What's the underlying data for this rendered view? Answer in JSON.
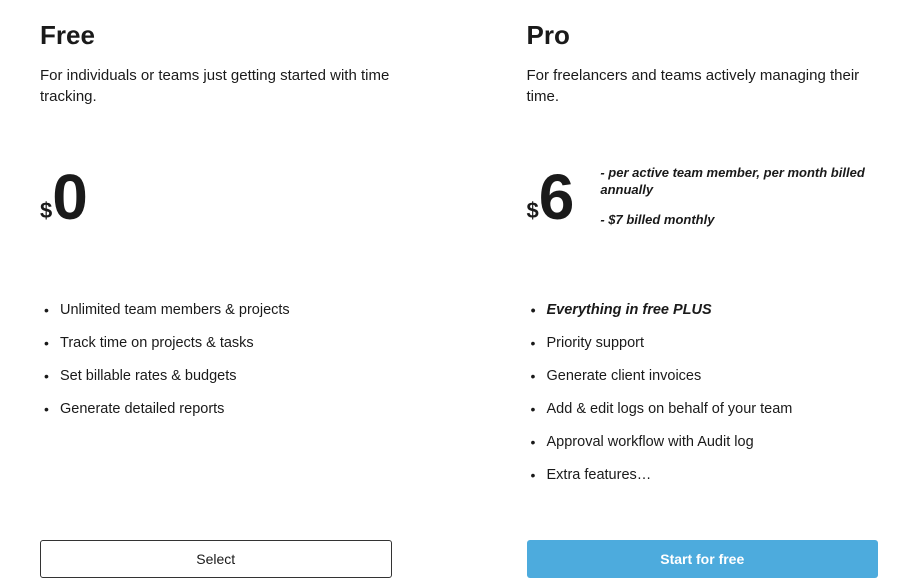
{
  "plans": {
    "free": {
      "title": "Free",
      "description": "For individuals or teams just getting started with time tracking.",
      "currency": "$",
      "amount": "0",
      "features": [
        "Unlimited team members & projects",
        "Track time on projects & tasks",
        "Set billable rates & budgets",
        "Generate detailed reports"
      ],
      "button_label": "Select"
    },
    "pro": {
      "title": "Pro",
      "description": "For freelancers and teams actively managing their time.",
      "currency": "$",
      "amount": "6",
      "notes": [
        "- per active team member, per month billed annually",
        "- $7 billed monthly"
      ],
      "features": [
        "Everything in free PLUS",
        "Priority support",
        "Generate client invoices",
        "Add & edit logs on behalf of your team",
        "Approval workflow with Audit log",
        "Extra features…"
      ],
      "button_label": "Start for free"
    }
  }
}
